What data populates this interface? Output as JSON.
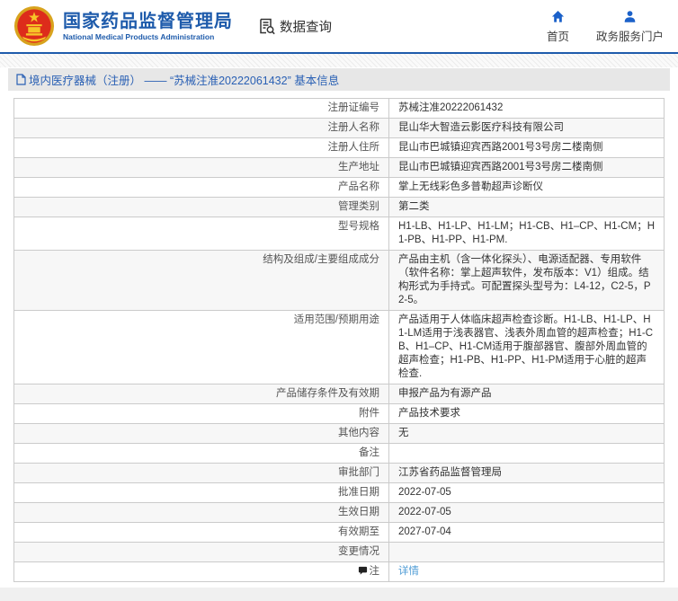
{
  "colors": {
    "accent": "#1e5bab",
    "breadcrumb": "#2a60b4",
    "link": "#4d9bd5",
    "stripe": "#f7f7f7",
    "nav-icon": "#1b61c9",
    "emblem-red": "#dd2c1b",
    "emblem-gold": "#f7c428"
  },
  "header": {
    "logo_icon": "china-national-emblem-icon",
    "title": "国家药品监督管理局",
    "subtitle": "National Medical Products Administration",
    "data_query_label": "数据查询",
    "data_query_icon": "document-search-icon",
    "nav": [
      {
        "label": "首页",
        "icon": "home-icon"
      },
      {
        "label": "政务服务门户",
        "icon": "person-icon"
      }
    ]
  },
  "breadcrumb": {
    "icon": "document-icon",
    "text": "境内医疗器械（注册） —— “苏械注准20222061432” 基本信息"
  },
  "table": {
    "rows": [
      {
        "label": "注册证编号",
        "value": "苏械注准20222061432"
      },
      {
        "label": "注册人名称",
        "value": "昆山华大智造云影医疗科技有限公司"
      },
      {
        "label": "注册人住所",
        "value": "昆山市巴城镇迎宾西路2001号3号房二楼南侧"
      },
      {
        "label": "生产地址",
        "value": "昆山市巴城镇迎宾西路2001号3号房二楼南侧"
      },
      {
        "label": "产品名称",
        "value": "掌上无线彩色多普勒超声诊断仪"
      },
      {
        "label": "管理类别",
        "value": "第二类"
      },
      {
        "label": "型号规格",
        "value": "H1-LB、H1-LP、H1-LM；H1-CB、H1–CP、H1-CM；H1-PB、H1-PP、H1-PM."
      },
      {
        "label": "结构及组成/主要组成成分",
        "value": "产品由主机（含一体化探头）、电源适配器、专用软件（软件名称：掌上超声软件，发布版本：V1）组成。结构形式为手持式。可配置探头型号为：L4-12，C2-5，P2-5。"
      },
      {
        "label": "适用范围/预期用途",
        "value": "产品适用于人体临床超声检查诊断。H1-LB、H1-LP、H1-LM适用于浅表器官、浅表外周血管的超声检查；H1-CB、H1–CP、H1-CM适用于腹部器官、腹部外周血管的超声检查；H1-PB、H1-PP、H1-PM适用于心脏的超声检查."
      },
      {
        "label": "产品储存条件及有效期",
        "value": "申报产品为有源产品"
      },
      {
        "label": "附件",
        "value": "产品技术要求"
      },
      {
        "label": "其他内容",
        "value": "无"
      },
      {
        "label": "备注",
        "value": ""
      },
      {
        "label": "审批部门",
        "value": "江苏省药品监督管理局"
      },
      {
        "label": "批准日期",
        "value": "2022-07-05"
      },
      {
        "label": "生效日期",
        "value": "2022-07-05"
      },
      {
        "label": "有效期至",
        "value": "2027-07-04"
      },
      {
        "label": "变更情况",
        "value": ""
      },
      {
        "label": "注",
        "label_icon": "comment-icon",
        "value": "详情",
        "value_is_link": true
      }
    ]
  }
}
